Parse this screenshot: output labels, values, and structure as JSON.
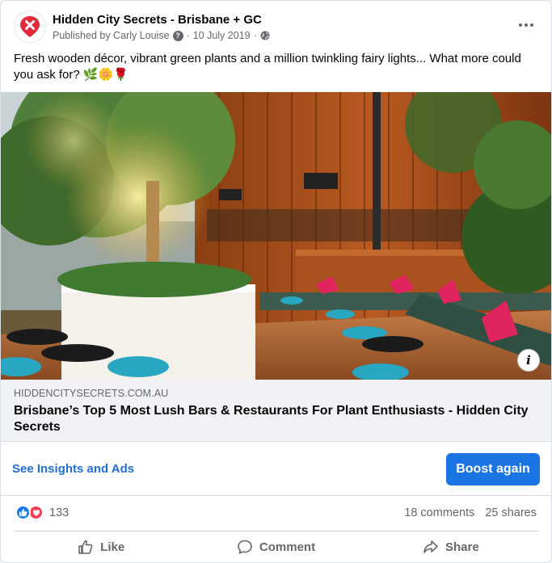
{
  "post": {
    "page_name": "Hidden City Secrets - Brisbane + GC",
    "published_by": "Published by Carly Louise",
    "date": "10 July 2019",
    "separator": "·",
    "caption": "Fresh wooden décor, vibrant green plants and a million twinkling fairy lights... What more could you ask for? 🌿🌼🌹"
  },
  "link_preview": {
    "domain": "HIDDENCITYSECRETS.COM.AU",
    "title": "Brisbane’s Top 5 Most Lush Bars & Restaurants For Plant Enthusiasts - Hidden City Secrets",
    "info_label": "i"
  },
  "promo": {
    "insights_label": "See Insights and Ads",
    "boost_label": "Boost again"
  },
  "engagement": {
    "reaction_count": "133",
    "comments": "18 comments",
    "shares": "25 shares"
  },
  "actions": {
    "like": "Like",
    "comment": "Comment",
    "share": "Share"
  },
  "colors": {
    "accent": "#1b74e4",
    "link": "#216fdb",
    "brand_red": "#e4293b",
    "like_blue": "#1877f2",
    "love_red": "#f33e58"
  },
  "icons": [
    "brand-logo-icon",
    "question-icon",
    "globe-icon",
    "more-icon",
    "info-icon",
    "like-reaction-icon",
    "love-reaction-icon",
    "thumbs-up-icon",
    "comment-icon",
    "share-icon"
  ]
}
